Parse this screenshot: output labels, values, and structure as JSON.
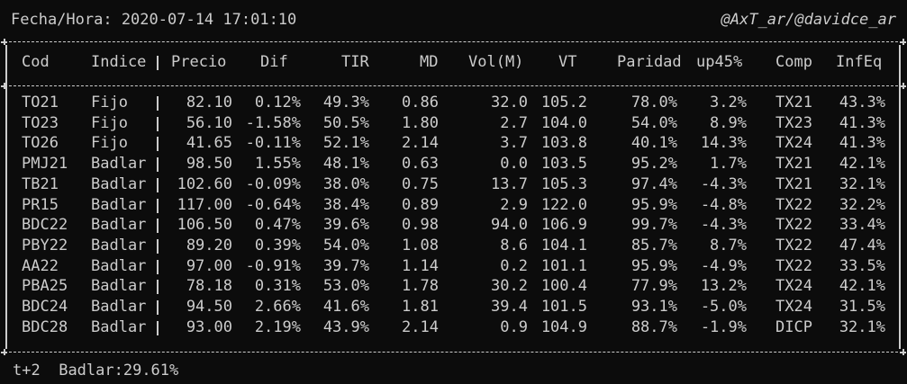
{
  "header": {
    "datetime_label": "Fecha/Hora: 2020-07-14 17:01:10",
    "credits": "@AxT_ar/@davidce_ar"
  },
  "table": {
    "columns": [
      "Cod",
      "Indice",
      "Precio",
      "Dif",
      "TIR",
      "MD",
      "Vol(M)",
      "VT",
      "Paridad",
      "up45%",
      "Comp",
      "InfEq"
    ],
    "rows": [
      [
        "TO21",
        "Fijo",
        "82.10",
        "0.12%",
        "49.3%",
        "0.86",
        "32.0",
        "105.2",
        "78.0%",
        "3.2%",
        "TX21",
        "43.3%"
      ],
      [
        "TO23",
        "Fijo",
        "56.10",
        "-1.58%",
        "50.5%",
        "1.80",
        "2.7",
        "104.0",
        "54.0%",
        "8.9%",
        "TX23",
        "41.3%"
      ],
      [
        "TO26",
        "Fijo",
        "41.65",
        "-0.11%",
        "52.1%",
        "2.14",
        "3.7",
        "103.8",
        "40.1%",
        "14.3%",
        "TX24",
        "41.3%"
      ],
      [
        "PMJ21",
        "Badlar",
        "98.50",
        "1.55%",
        "48.1%",
        "0.63",
        "0.0",
        "103.5",
        "95.2%",
        "1.7%",
        "TX21",
        "42.1%"
      ],
      [
        "TB21",
        "Badlar",
        "102.60",
        "-0.09%",
        "38.0%",
        "0.75",
        "13.7",
        "105.3",
        "97.4%",
        "-4.3%",
        "TX21",
        "32.1%"
      ],
      [
        "PR15",
        "Badlar",
        "117.00",
        "-0.64%",
        "38.4%",
        "0.89",
        "2.9",
        "122.0",
        "95.9%",
        "-4.8%",
        "TX22",
        "32.2%"
      ],
      [
        "BDC22",
        "Badlar",
        "106.50",
        "0.47%",
        "39.6%",
        "0.98",
        "94.0",
        "106.9",
        "99.7%",
        "-4.3%",
        "TX22",
        "33.4%"
      ],
      [
        "PBY22",
        "Badlar",
        "89.20",
        "0.39%",
        "54.0%",
        "1.08",
        "8.6",
        "104.1",
        "85.7%",
        "8.7%",
        "TX22",
        "47.4%"
      ],
      [
        "AA22",
        "Badlar",
        "97.00",
        "-0.91%",
        "39.7%",
        "1.14",
        "0.2",
        "101.1",
        "95.9%",
        "-4.9%",
        "TX22",
        "33.5%"
      ],
      [
        "PBA25",
        "Badlar",
        "78.18",
        "0.31%",
        "53.0%",
        "1.78",
        "30.2",
        "100.4",
        "77.9%",
        "13.2%",
        "TX24",
        "42.1%"
      ],
      [
        "BDC24",
        "Badlar",
        "94.50",
        "2.66%",
        "41.6%",
        "1.81",
        "39.4",
        "101.5",
        "93.1%",
        "-5.0%",
        "TX24",
        "31.5%"
      ],
      [
        "BDC28",
        "Badlar",
        "93.00",
        "2.19%",
        "43.9%",
        "2.14",
        "0.9",
        "104.9",
        "88.7%",
        "-1.9%",
        "DICP",
        "32.1%"
      ]
    ]
  },
  "footer": {
    "settlement": "t+2",
    "badlar_rate": "Badlar:29.61%"
  },
  "colors": {
    "background": "#0c0c0c",
    "text": "#cccccc"
  }
}
